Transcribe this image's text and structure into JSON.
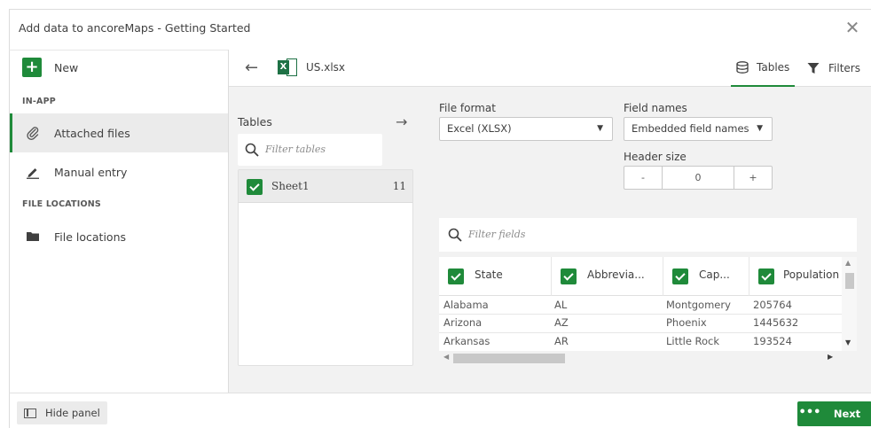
{
  "dialog": {
    "title": "Add data to ancoreMaps - Getting Started",
    "close_glyph": "✕"
  },
  "sidebar": {
    "new_label": "New",
    "section_inapp": "IN-APP",
    "items": [
      {
        "label": "Attached files",
        "icon": "paperclip-icon",
        "active": true
      },
      {
        "label": "Manual entry",
        "icon": "pencil-icon",
        "active": false
      }
    ],
    "section_locations": "FILE LOCATIONS",
    "locations": [
      {
        "label": "File locations",
        "icon": "folder-icon"
      }
    ]
  },
  "toolbar": {
    "back_glyph": "←",
    "file_name": "US.xlsx",
    "tabs_label": "Tables",
    "filters_label": "Filters"
  },
  "tables": {
    "label": "Tables",
    "arrow_glyph": "→",
    "filter_placeholder": "Filter tables",
    "sheets": [
      {
        "name": "Sheet1",
        "count": "11"
      }
    ]
  },
  "options": {
    "file_format_label": "File format",
    "file_format_value": "Excel (XLSX)",
    "field_names_label": "Field names",
    "field_names_value": "Embedded field names",
    "header_size_label": "Header size",
    "header_size_value": "0",
    "minus": "-",
    "plus": "+"
  },
  "fields": {
    "filter_placeholder": "Filter fields",
    "columns": [
      "State",
      "Abbrevia...",
      "Cap...",
      "Population"
    ],
    "rows": [
      [
        "Alabama",
        "AL",
        "Montgomery",
        "205764"
      ],
      [
        "Arizona",
        "AZ",
        "Phoenix",
        "1445632"
      ],
      [
        "Arkansas",
        "AR",
        "Little Rock",
        "193524"
      ]
    ]
  },
  "footer": {
    "hide_panel_label": "Hide panel",
    "more_glyph": "•••",
    "next_label": "Next"
  },
  "colors": {
    "accent": "#1f8a3a",
    "excel": "#1e7145"
  }
}
